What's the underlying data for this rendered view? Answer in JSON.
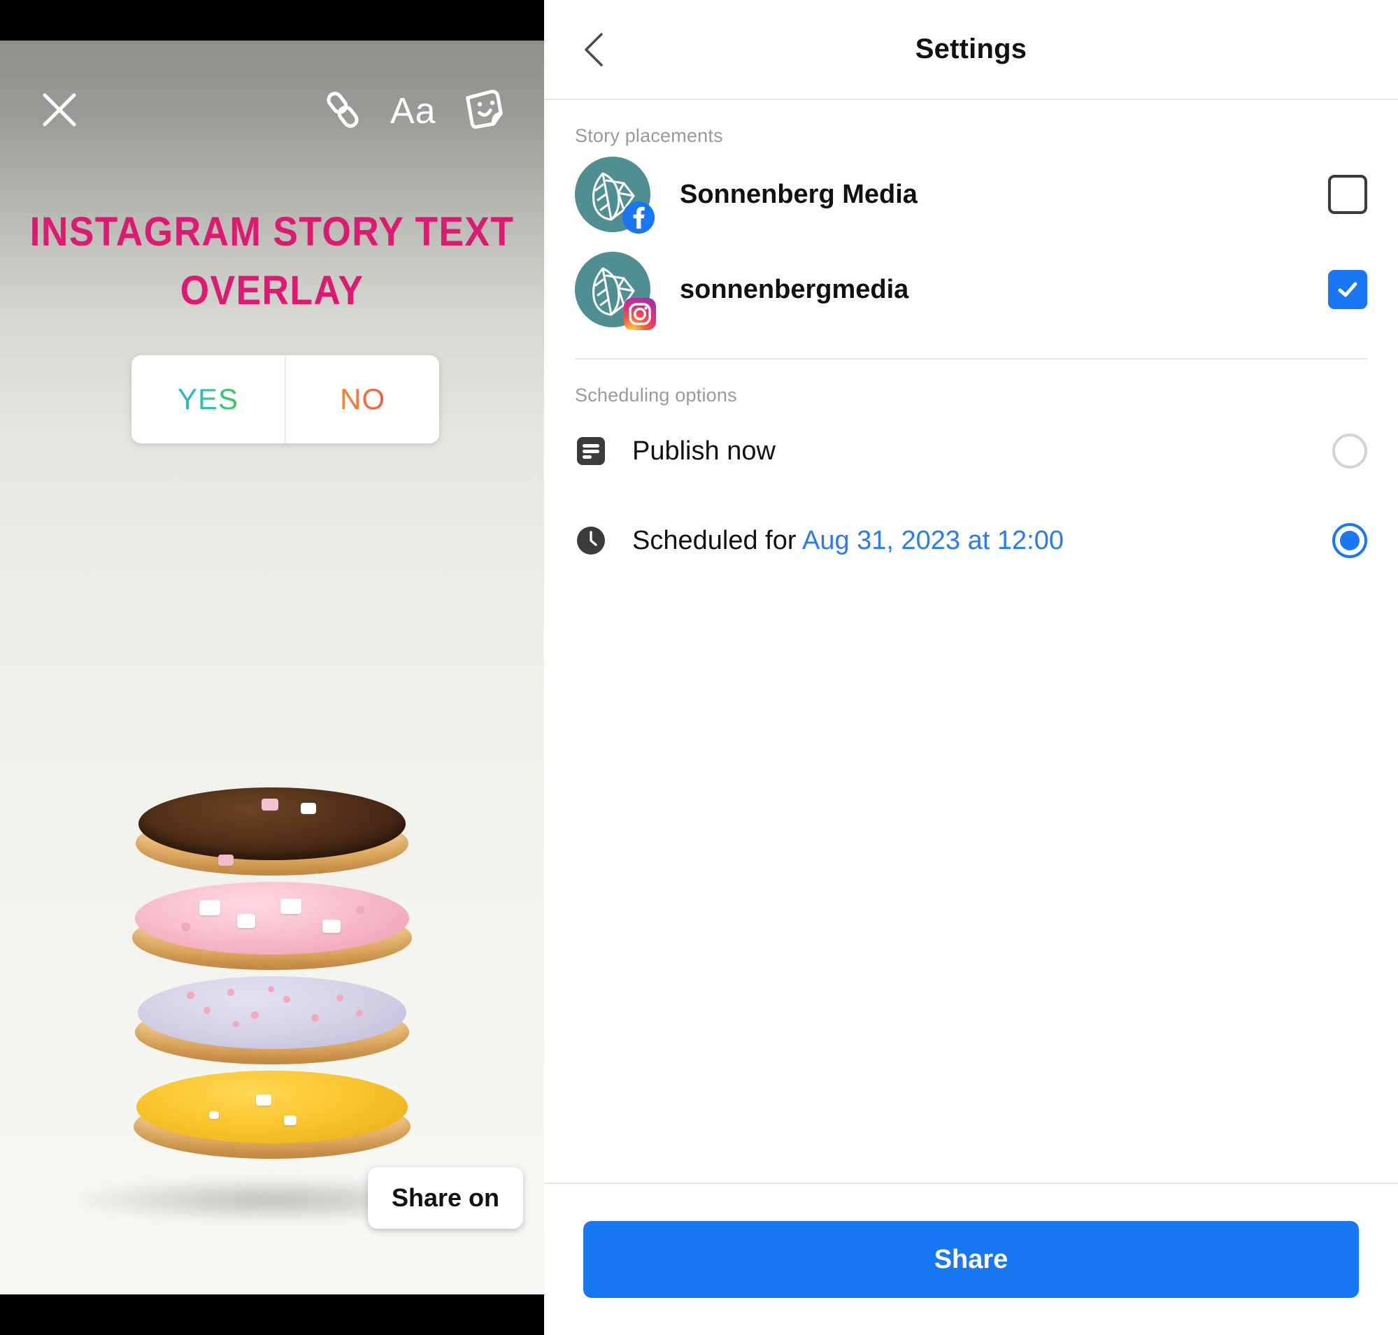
{
  "story": {
    "close_icon": "close-x-icon",
    "toolbar": [
      {
        "name": "link-icon",
        "label": "Link"
      },
      {
        "name": "text-icon",
        "label": "Aa"
      },
      {
        "name": "sticker-icon",
        "label": "Sticker"
      }
    ],
    "headline": "Instagram Story Text Overlay",
    "poll": {
      "yes_label": "YES",
      "no_label": "NO"
    },
    "share_on_label": "Share on",
    "headline_color": "#DD1A72"
  },
  "settings": {
    "title": "Settings",
    "back_icon": "chevron-left-icon",
    "placements_label": "Story placements",
    "placements": [
      {
        "name": "Sonnenberg Media",
        "platform": "facebook",
        "checked": false
      },
      {
        "name": "sonnenbergmedia",
        "platform": "instagram",
        "checked": true
      }
    ],
    "scheduling_label": "Scheduling options",
    "scheduling": [
      {
        "icon": "publish-now-icon",
        "label": "Publish now",
        "accent": "",
        "selected": false
      },
      {
        "icon": "clock-icon",
        "label": "Scheduled for ",
        "accent": "Aug 31, 2023 at 12:00",
        "selected": true
      }
    ],
    "share_label": "Share",
    "accent_color": "#1877F2"
  }
}
